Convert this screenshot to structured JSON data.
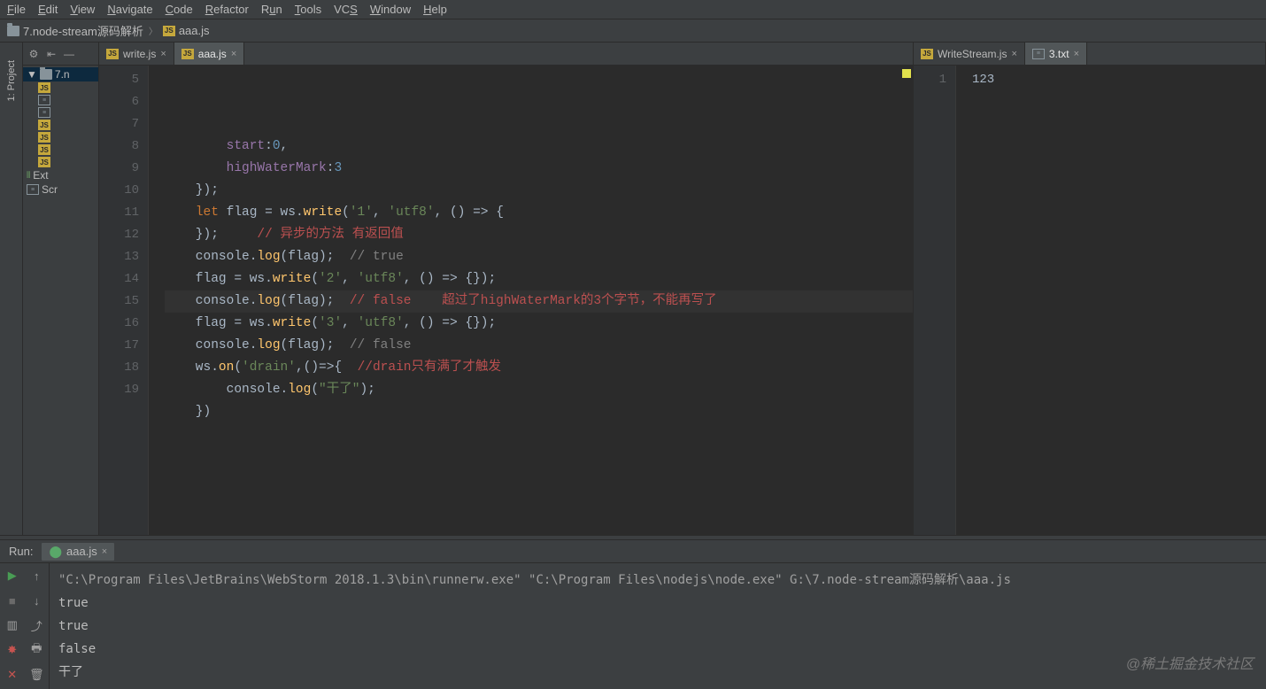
{
  "menu": {
    "file": "File",
    "edit": "Edit",
    "view": "View",
    "navigate": "Navigate",
    "code": "Code",
    "refactor": "Refactor",
    "run": "Run",
    "tools": "Tools",
    "vcs": "VCS",
    "window": "Window",
    "help": "Help"
  },
  "breadcrumb": {
    "folder": "7.node-stream源码解析",
    "file": "aaa.js"
  },
  "sideLabels": {
    "project": "1: Project"
  },
  "projectTree": {
    "root": "7.n",
    "items": [
      "",
      "",
      "",
      "",
      "",
      "",
      "",
      ""
    ],
    "ext": "Ext",
    "scr": "Scr"
  },
  "leftTabs": [
    {
      "label": "write.js",
      "active": false
    },
    {
      "label": "aaa.js",
      "active": true
    }
  ],
  "rightTabs": [
    {
      "label": "WriteStream.js",
      "active": false,
      "type": "js"
    },
    {
      "label": "3.txt",
      "active": true,
      "type": "txt"
    }
  ],
  "leftEditor": {
    "firstLine": 5,
    "highlightLine": 13,
    "lines": [
      {
        "n": 5,
        "seg": [
          {
            "t": "        ",
            "c": "op"
          },
          {
            "t": "start",
            "c": "prop"
          },
          {
            "t": ":",
            "c": "op"
          },
          {
            "t": "0",
            "c": "num"
          },
          {
            "t": ",",
            "c": "op"
          }
        ]
      },
      {
        "n": 6,
        "seg": [
          {
            "t": "        ",
            "c": "op"
          },
          {
            "t": "highWaterMark",
            "c": "prop"
          },
          {
            "t": ":",
            "c": "op"
          },
          {
            "t": "3",
            "c": "num"
          }
        ]
      },
      {
        "n": 7,
        "seg": [
          {
            "t": "    });",
            "c": "op"
          }
        ]
      },
      {
        "n": 8,
        "seg": [
          {
            "t": "    ",
            "c": "op"
          },
          {
            "t": "let ",
            "c": "kw"
          },
          {
            "t": "flag = ws.",
            "c": "op"
          },
          {
            "t": "write",
            "c": "fn"
          },
          {
            "t": "(",
            "c": "op"
          },
          {
            "t": "'1'",
            "c": "str"
          },
          {
            "t": ", ",
            "c": "op"
          },
          {
            "t": "'utf8'",
            "c": "str"
          },
          {
            "t": ", () => {",
            "c": "op"
          }
        ]
      },
      {
        "n": 9,
        "seg": [
          {
            "t": "    });     ",
            "c": "op"
          },
          {
            "t": "// 异步的方法 有返回值",
            "c": "cmtred"
          }
        ]
      },
      {
        "n": 10,
        "seg": [
          {
            "t": "",
            "c": "op"
          }
        ]
      },
      {
        "n": 11,
        "seg": [
          {
            "t": "    console.",
            "c": "op"
          },
          {
            "t": "log",
            "c": "fn"
          },
          {
            "t": "(flag);  ",
            "c": "op"
          },
          {
            "t": "// true",
            "c": "cmt"
          }
        ]
      },
      {
        "n": 12,
        "seg": [
          {
            "t": "    flag = ws.",
            "c": "op"
          },
          {
            "t": "write",
            "c": "fn"
          },
          {
            "t": "(",
            "c": "op"
          },
          {
            "t": "'2'",
            "c": "str"
          },
          {
            "t": ", ",
            "c": "op"
          },
          {
            "t": "'utf8'",
            "c": "str"
          },
          {
            "t": ", () => {});",
            "c": "op"
          }
        ]
      },
      {
        "n": 13,
        "seg": [
          {
            "t": "    console.",
            "c": "op"
          },
          {
            "t": "log",
            "c": "fn"
          },
          {
            "t": "(flag);  ",
            "c": "op"
          },
          {
            "t": "// false    超过了highWaterMark的3个字节，不能再写了",
            "c": "cmtred"
          }
        ]
      },
      {
        "n": 14,
        "seg": [
          {
            "t": "    flag = ws.",
            "c": "op"
          },
          {
            "t": "write",
            "c": "fn"
          },
          {
            "t": "(",
            "c": "op"
          },
          {
            "t": "'3'",
            "c": "str"
          },
          {
            "t": ", ",
            "c": "op"
          },
          {
            "t": "'utf8'",
            "c": "str"
          },
          {
            "t": ", () => {});",
            "c": "op"
          }
        ]
      },
      {
        "n": 15,
        "seg": [
          {
            "t": "    console.",
            "c": "op"
          },
          {
            "t": "log",
            "c": "fn"
          },
          {
            "t": "(flag);  ",
            "c": "op"
          },
          {
            "t": "// false",
            "c": "cmt"
          }
        ]
      },
      {
        "n": 16,
        "seg": [
          {
            "t": "",
            "c": "op"
          }
        ]
      },
      {
        "n": 17,
        "seg": [
          {
            "t": "    ws.",
            "c": "op"
          },
          {
            "t": "on",
            "c": "fn"
          },
          {
            "t": "(",
            "c": "op"
          },
          {
            "t": "'drain'",
            "c": "str"
          },
          {
            "t": ",()=>{  ",
            "c": "op"
          },
          {
            "t": "//drain只有满了才触发",
            "c": "cmtred"
          }
        ]
      },
      {
        "n": 18,
        "seg": [
          {
            "t": "        console.",
            "c": "op"
          },
          {
            "t": "log",
            "c": "fn"
          },
          {
            "t": "(",
            "c": "op"
          },
          {
            "t": "\"干了\"",
            "c": "str"
          },
          {
            "t": ");",
            "c": "op"
          }
        ]
      },
      {
        "n": 19,
        "seg": [
          {
            "t": "    })",
            "c": "op"
          }
        ]
      }
    ]
  },
  "rightEditor": {
    "line": "1",
    "content": "123"
  },
  "runPanel": {
    "title": "Run:",
    "tab": "aaa.js",
    "cmd": "\"C:\\Program Files\\JetBrains\\WebStorm 2018.1.3\\bin\\runnerw.exe\" \"C:\\Program Files\\nodejs\\node.exe\" G:\\7.node-stream源码解析\\aaa.js",
    "lines": [
      "true",
      "true",
      "false",
      "干了"
    ]
  },
  "watermark": "@稀土掘金技术社区"
}
